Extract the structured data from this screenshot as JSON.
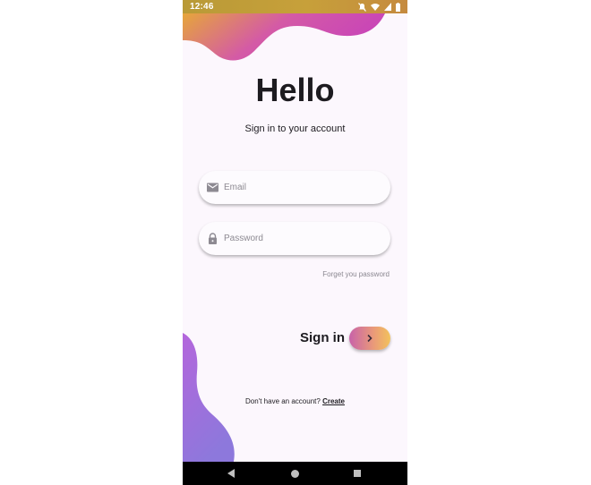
{
  "status_bar": {
    "time": "12:46",
    "icons": [
      "mute-icon",
      "wifi-icon",
      "signal-icon",
      "battery-icon"
    ]
  },
  "screen": {
    "title": "Hello",
    "subtitle": "Sign in to your account"
  },
  "form": {
    "email": {
      "placeholder": "Email",
      "value": "",
      "icon": "mail-icon"
    },
    "password": {
      "placeholder": "Password",
      "value": "",
      "icon": "lock-icon"
    },
    "forgot_link": "Forget you password"
  },
  "sign_in": {
    "label": "Sign in",
    "button_icon": "chevron-right-icon"
  },
  "signup": {
    "prompt": "Don't have an account?",
    "link": "Create"
  },
  "nav_bar": {
    "buttons": [
      "back-icon",
      "home-icon",
      "recents-icon"
    ]
  },
  "colors": {
    "background": "#fcf7fd",
    "blob_top_start": "#e6a63a",
    "blob_top_end": "#c844b8",
    "blob_bottom_start": "#b466dc",
    "blob_bottom_end": "#8d78dc",
    "button_start": "#c862a9",
    "button_end": "#f2c25c",
    "text": "#1d1b20"
  }
}
